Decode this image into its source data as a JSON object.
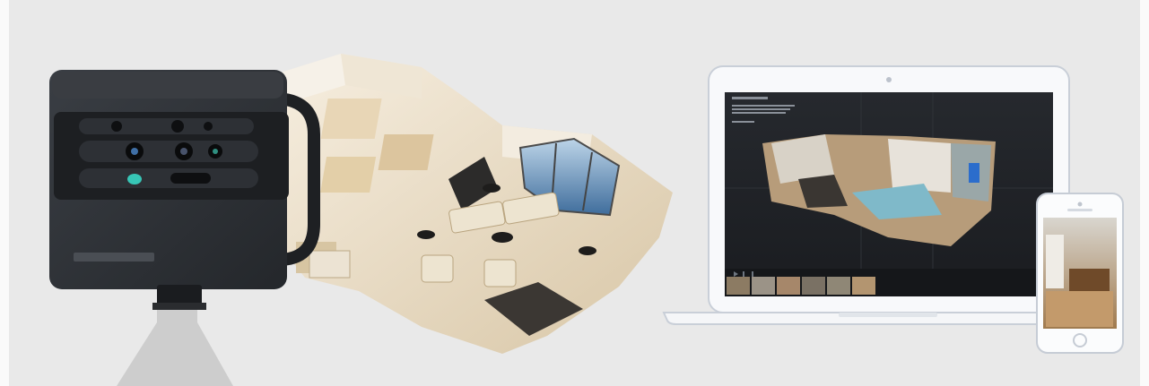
{
  "scene": {
    "background": "#e9e9e9",
    "camera_brand": "",
    "laptop_viewer_title": "",
    "phone_present": true,
    "thumbnail_count": 6
  },
  "colors": {
    "camera_body": "#2c2f33",
    "camera_dark": "#1b1d20",
    "lens_accent": "#37c6b6",
    "floor_plan_light": "#efe1c8",
    "floor_plan_wall": "#f6f1e8",
    "laptop_frame": "#c9cfd8",
    "laptop_screen": "#1f2226",
    "phone_frame": "#d6dbe2"
  }
}
